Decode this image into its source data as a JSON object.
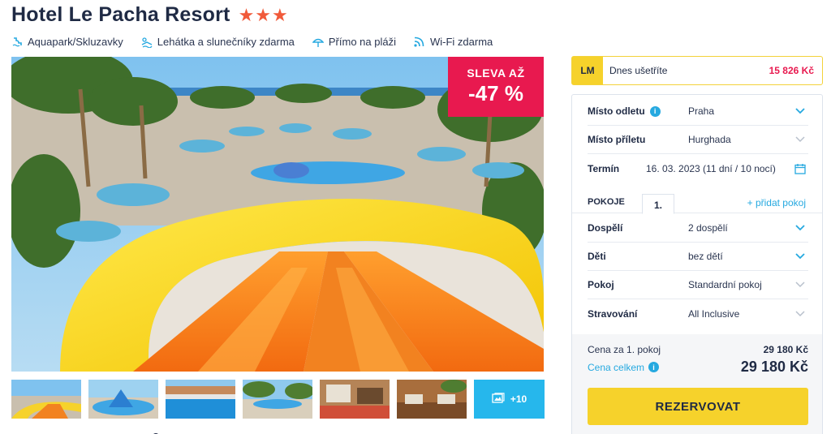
{
  "hotel": {
    "name": "Hotel Le Pacha Resort",
    "stars": "★★★"
  },
  "amenities": [
    {
      "label": "Aquapark/Skluzavky",
      "icon": "aquapark-icon"
    },
    {
      "label": "Lehátka a slunečníky zdarma",
      "icon": "sunbed-icon"
    },
    {
      "label": "Přímo na pláži",
      "icon": "beach-umbrella-icon"
    },
    {
      "label": "Wi-Fi zdarma",
      "icon": "wifi-icon"
    }
  ],
  "discount": {
    "line1": "SLEVA AŽ",
    "line2": "-47 %",
    "color": "#e8194f"
  },
  "gallery": {
    "more_label": "+10"
  },
  "lastminute": {
    "badge": "LM",
    "text": "Dnes ušetříte",
    "saving": "15 826 Kč"
  },
  "booking": {
    "departure": {
      "label": "Místo odletu",
      "value": "Praha"
    },
    "arrival": {
      "label": "Místo příletu",
      "value": "Hurghada"
    },
    "term": {
      "label": "Termín",
      "value": "16. 03. 2023 (11 dní / 10 nocí)"
    },
    "rooms_label": "POKOJE",
    "room_tab": "1.",
    "add_room": "+ přidat pokoj",
    "adults": {
      "label": "Dospělí",
      "value": "2 dospělí"
    },
    "children": {
      "label": "Děti",
      "value": "bez dětí"
    },
    "room": {
      "label": "Pokoj",
      "value": "Standardní pokoj"
    },
    "board": {
      "label": "Stravování",
      "value": "All Inclusive"
    }
  },
  "price": {
    "room_label": "Cena za 1. pokoj",
    "room_value": "29 180 Kč",
    "total_label": "Cena celkem",
    "total_value": "29 180 Kč"
  },
  "reserve_label": "REZERVOVAT",
  "colors": {
    "accent_yellow": "#f6d22b",
    "accent_blue": "#26a9e0",
    "sale_red": "#e8194f",
    "star": "#f15a3a"
  }
}
